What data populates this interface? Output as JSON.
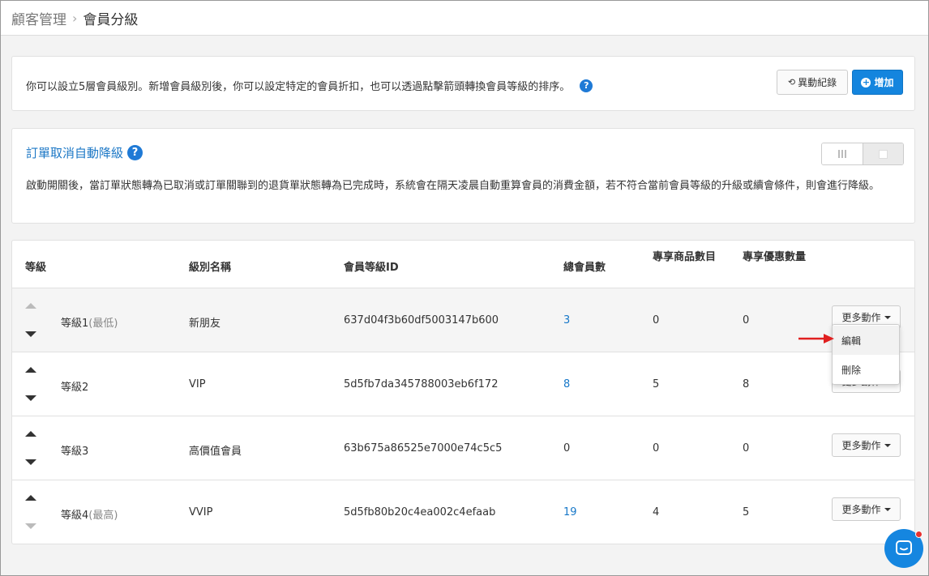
{
  "breadcrumb": {
    "parent": "顧客管理",
    "separator": "›",
    "current": "會員分級"
  },
  "info": {
    "text": "你可以設立5層會員級別。新增會員級別後，你可以設定特定的會員折扣，也可以透過點擊箭頭轉換會員等級的排序。",
    "history_label": "異動紀錄",
    "add_label": "增加"
  },
  "downgrade": {
    "title": "訂單取消自動降級",
    "description": "啟動開關後，當訂單狀態轉為已取消或訂單關聯到的退貨單狀態轉為已完成時，系統會在隔天凌晨自動重算會員的消費金額，若不符合當前會員等級的升級或續會條件，則會進行降級。",
    "toggle_state": "off"
  },
  "table": {
    "headers": {
      "level": "等級",
      "name": "級別名稱",
      "id": "會員等級ID",
      "members": "總會員數",
      "products": "專享商品數目",
      "coupons": "專享優惠數量"
    },
    "more_label": "更多動作",
    "rows": [
      {
        "level": "等級1",
        "note": "(最低)",
        "name": "新朋友",
        "id": "637d04f3b60df5003147b600",
        "members": "3",
        "products": "0",
        "coupons": "0",
        "up_enabled": false,
        "down_enabled": true
      },
      {
        "level": "等級2",
        "note": "",
        "name": "VIP",
        "id": "5d5fb7da345788003eb6f172",
        "members": "8",
        "products": "5",
        "coupons": "8",
        "up_enabled": true,
        "down_enabled": true
      },
      {
        "level": "等級3",
        "note": "",
        "name": "高價值會員",
        "id": "63b675a86525e7000e74c5c5",
        "members": "0",
        "products": "0",
        "coupons": "0",
        "up_enabled": true,
        "down_enabled": true
      },
      {
        "level": "等級4",
        "note": "(最高)",
        "name": "VVIP",
        "id": "5d5fb80b20c4ea002c4efaab",
        "members": "19",
        "products": "4",
        "coupons": "5",
        "up_enabled": true,
        "down_enabled": false
      }
    ]
  },
  "dropdown": {
    "edit": "編輯",
    "delete": "刪除"
  },
  "colors": {
    "accent": "#1485de",
    "link": "#1677c8",
    "arrow": "#e02020"
  },
  "icons": {
    "history": "history-icon",
    "add": "plus-circle-icon",
    "help": "question-circle-icon",
    "chat": "chat-bubble-icon"
  }
}
